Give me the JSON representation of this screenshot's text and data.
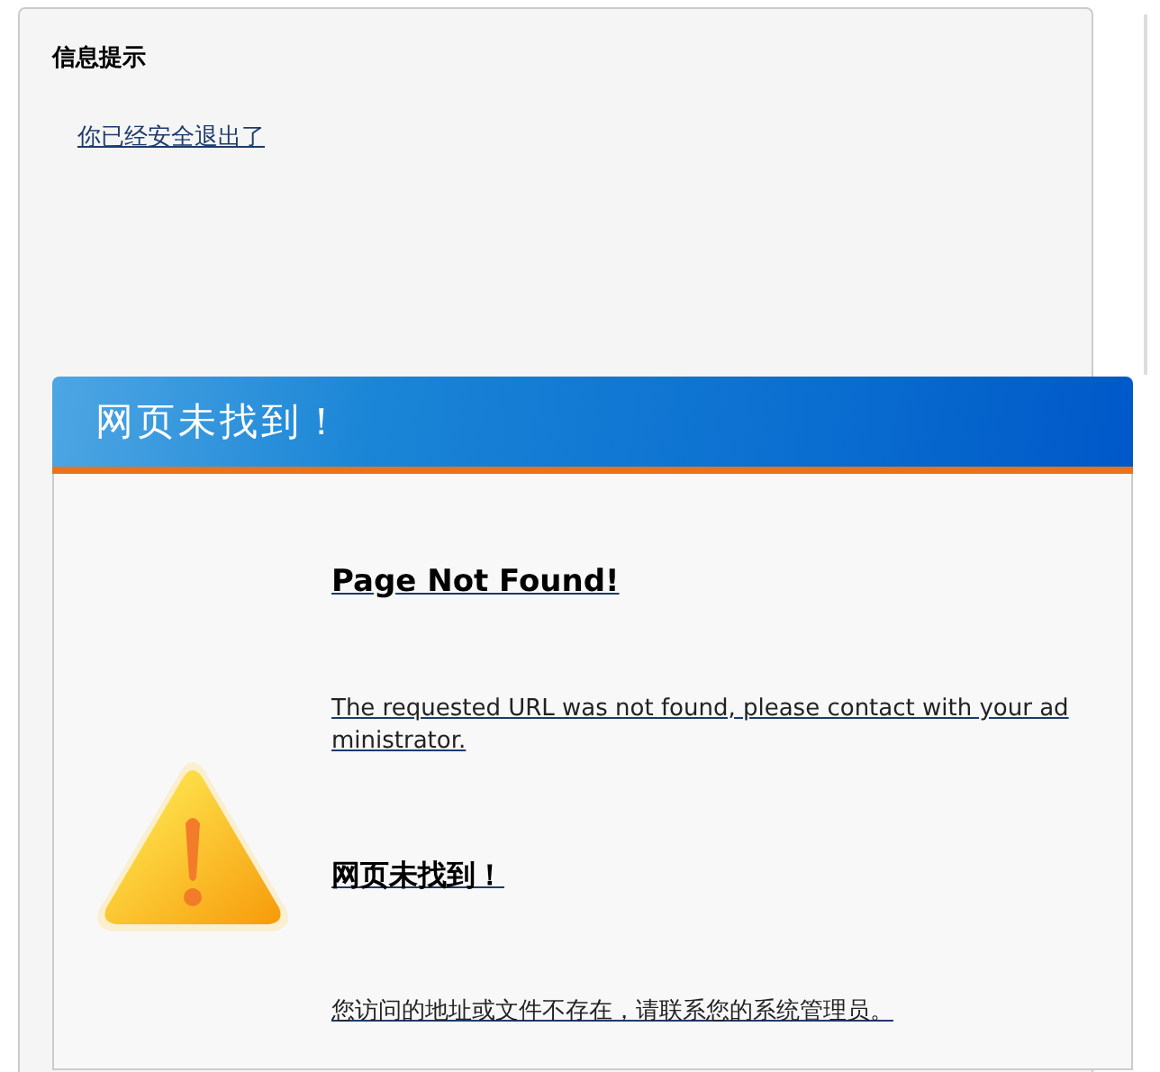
{
  "info_panel": {
    "title": "信息提示",
    "message": "你已经安全退出了"
  },
  "error_card": {
    "header": "网页未找到！",
    "heading_en": "Page Not Found!",
    "message_en": "The requested URL was not found, please contact with your administrator.",
    "heading_zh": "网页未找到！",
    "message_zh": "您访问的地址或文件不存在，请联系您的系统管理员。"
  }
}
